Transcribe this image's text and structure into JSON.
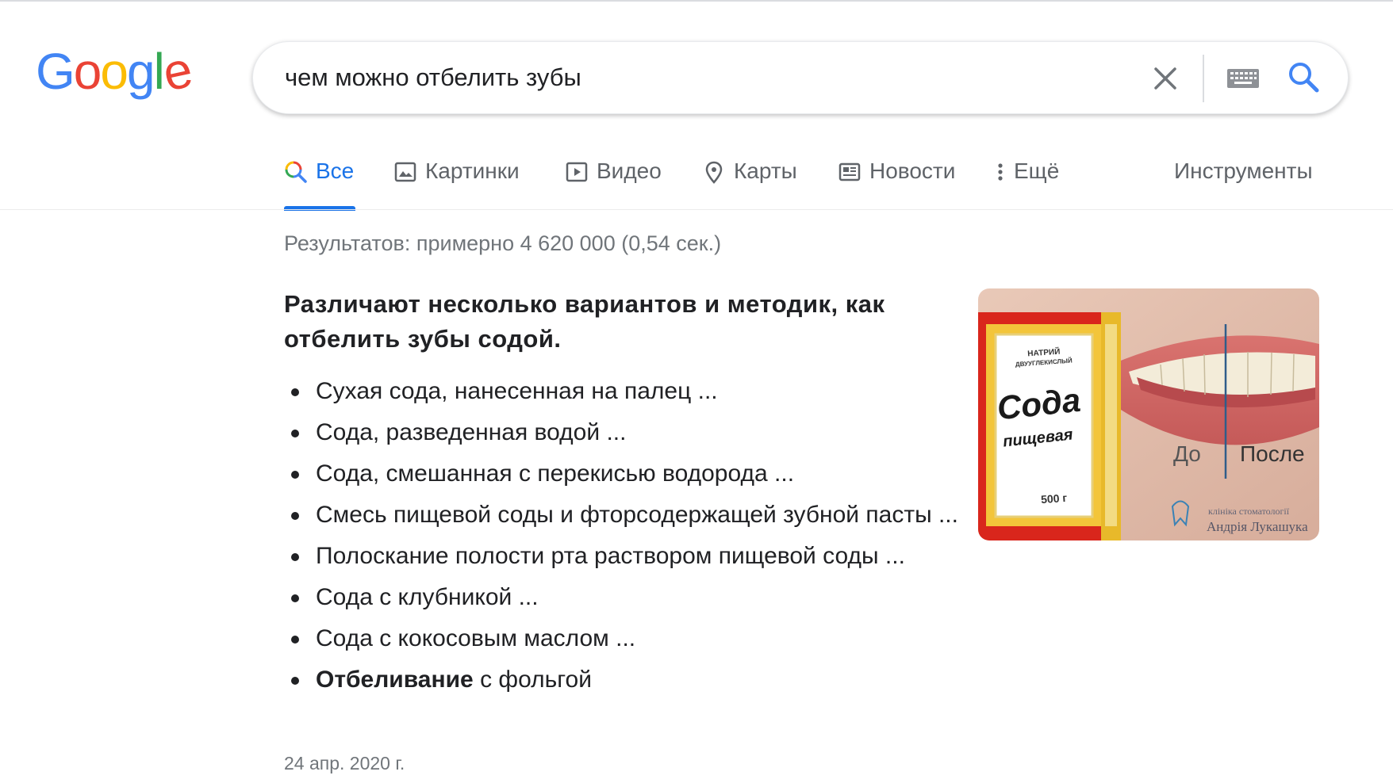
{
  "logo": {
    "letters": [
      "G",
      "o",
      "o",
      "g",
      "l",
      "e"
    ],
    "colors": [
      "#4285f4",
      "#ea4335",
      "#fbbc05",
      "#4285f4",
      "#34a853",
      "#ea4335"
    ]
  },
  "search": {
    "query": "чем можно отбелить зубы"
  },
  "icons": {
    "clear": "close-icon",
    "keyboard": "keyboard-icon",
    "search": "search-icon"
  },
  "tabs": [
    {
      "label": "Все",
      "icon": "search-multicolor-icon",
      "active": true
    },
    {
      "label": "Картинки",
      "icon": "image-icon",
      "active": false
    },
    {
      "label": "Видео",
      "icon": "play-icon",
      "active": false
    },
    {
      "label": "Карты",
      "icon": "map-pin-icon",
      "active": false
    },
    {
      "label": "Новости",
      "icon": "news-icon",
      "active": false
    },
    {
      "label": "Ещё",
      "icon": "more-vert-icon",
      "active": false
    }
  ],
  "tools_label": "Инструменты",
  "stats": "Результатов: примерно 4 620 000 (0,54 сек.)",
  "snippet": {
    "heading": "Различают несколько вариантов и методик, как отбелить зубы содой.",
    "items": [
      "Сухая сода, нанесенная на палец ...",
      "Сода, разведенная водой ...",
      "Сода, смешанная с перекисью водорода ...",
      "Смесь пищевой соды и фторсодержащей зубной пасты ...",
      "Полоскание полости рта раствором пищевой соды ...",
      "Сода с клубникой ...",
      "Сода с кокосовым маслом ..."
    ],
    "last_item": {
      "bold": "Отбеливание",
      "rest": " с фольгой"
    },
    "date": "24 апр. 2020 г.",
    "image": {
      "box_top": "НАТРИЙ",
      "box_sub": "ДВУУГЛЕКИСЛЫЙ",
      "box_brand": "Сода",
      "box_type": "пищевая",
      "box_weight": "500 г",
      "before": "До",
      "after": "После",
      "watermark_1": "клініка стоматології",
      "watermark_2": "Андрія Лукашука"
    }
  },
  "colors": {
    "accent": "#1a73e8",
    "muted": "#70757a",
    "tab_text": "#5f6368",
    "text": "#202124"
  }
}
